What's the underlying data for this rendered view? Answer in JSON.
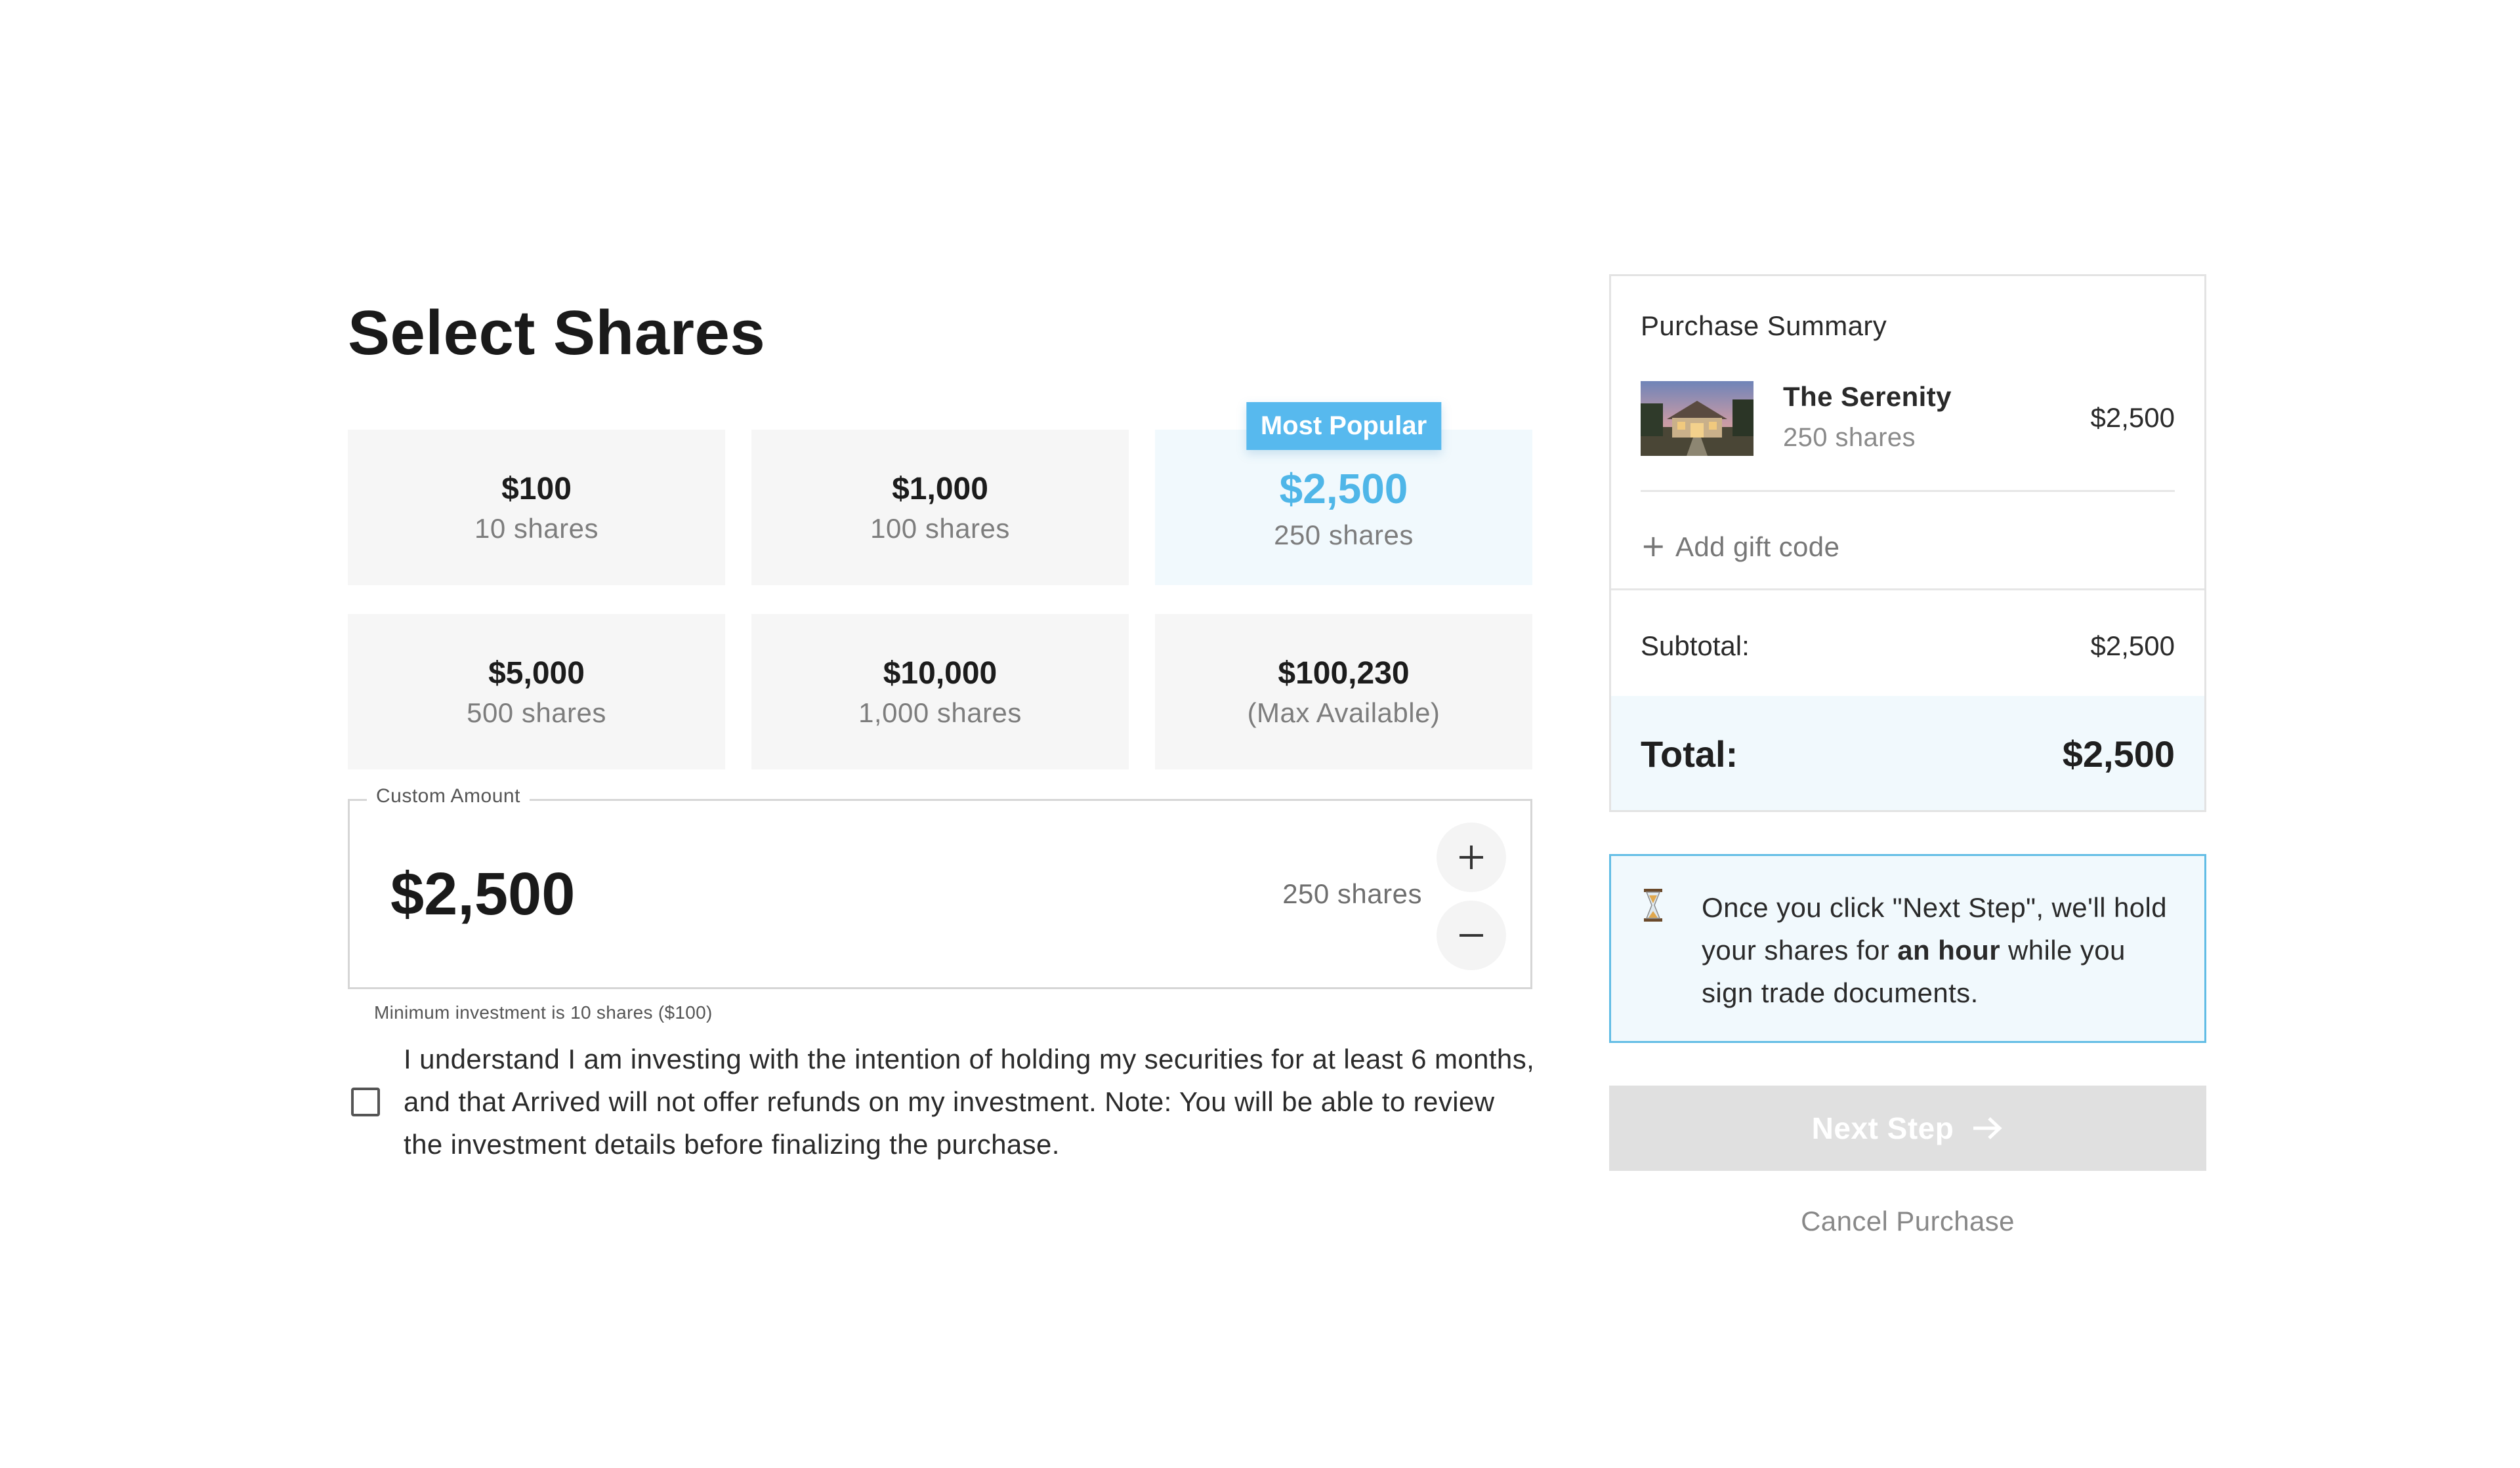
{
  "title": "Select Shares",
  "options": [
    {
      "price": "$100",
      "shares": "10 shares"
    },
    {
      "price": "$1,000",
      "shares": "100 shares"
    },
    {
      "price": "$2,500",
      "shares": "250 shares",
      "badge": "Most Popular",
      "selected": true
    },
    {
      "price": "$5,000",
      "shares": "500 shares"
    },
    {
      "price": "$10,000",
      "shares": "1,000 shares"
    },
    {
      "price": "$100,230",
      "shares": "(Max Available)"
    }
  ],
  "custom": {
    "legend": "Custom Amount",
    "amount": "$2,500",
    "shares": "250 shares",
    "increment_icon": "plus-icon",
    "decrement_icon": "minus-icon",
    "min_note": "Minimum investment is 10 shares ($100)"
  },
  "agreement": {
    "checked": false,
    "text": "I understand I am investing with the intention of holding my securities for at least 6 months, and that Arrived will not offer refunds on my investment. Note: You will be able to review the investment details before finalizing the purchase."
  },
  "summary": {
    "title": "Purchase Summary",
    "item": {
      "name": "The Serenity",
      "shares": "250 shares",
      "price": "$2,500"
    },
    "gift_label": "Add gift code",
    "subtotal_label": "Subtotal:",
    "subtotal_value": "$2,500",
    "total_label": "Total:",
    "total_value": "$2,500"
  },
  "notice": {
    "icon": "hourglass-icon",
    "text_before": "Once you click \"Next Step\", we'll hold your shares for ",
    "text_bold": "an hour",
    "text_after": " while you sign trade documents."
  },
  "actions": {
    "next_label": "Next Step",
    "next_enabled": false,
    "cancel_label": "Cancel Purchase"
  },
  "colors": {
    "accent": "#57b9ee",
    "selected_bg": "#f1f9fd",
    "card_bg": "#f6f6f6",
    "disabled_button": "#e0e0e0"
  }
}
